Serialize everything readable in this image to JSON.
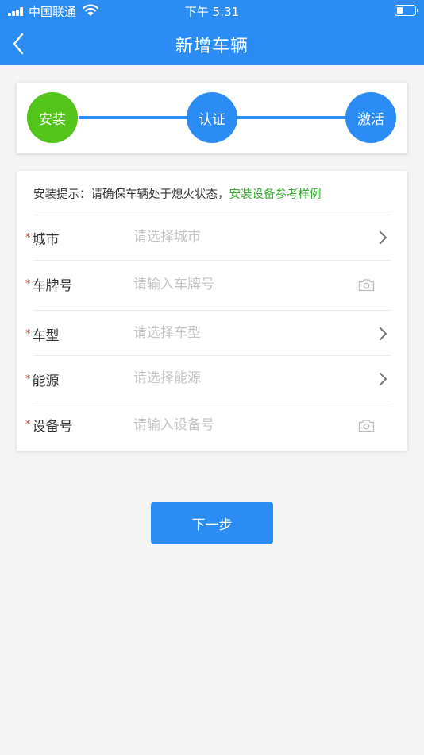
{
  "status_bar": {
    "carrier": "中国联通",
    "time": "下午 5:31"
  },
  "nav": {
    "title": "新增车辆"
  },
  "steps": [
    {
      "label": "安装",
      "color": "#52c41a"
    },
    {
      "label": "认证",
      "color": "#2b8cf3"
    },
    {
      "label": "激活",
      "color": "#2b8cf3"
    }
  ],
  "form": {
    "tip_prefix": "安装提示：请确保车辆处于熄火状态，",
    "tip_link": "安装设备参考样例",
    "required_mark": "*",
    "fields": [
      {
        "label": "城市",
        "placeholder": "请选择城市",
        "icon": "chevron-right-icon"
      },
      {
        "label": "车牌号",
        "placeholder": "请输入车牌号",
        "icon": "camera-icon"
      },
      {
        "label": "车型",
        "placeholder": "请选择车型",
        "icon": "chevron-right-icon"
      },
      {
        "label": "能源",
        "placeholder": "请选择能源",
        "icon": "chevron-right-icon"
      },
      {
        "label": "设备号",
        "placeholder": "请输入设备号",
        "icon": "camera-icon"
      }
    ]
  },
  "next_button": {
    "label": "下一步"
  }
}
